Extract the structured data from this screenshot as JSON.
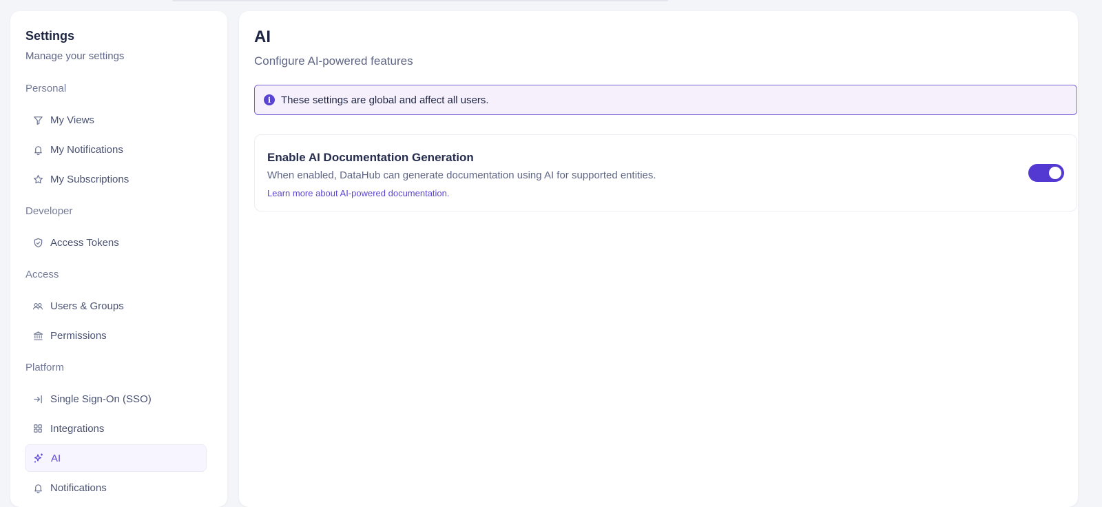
{
  "sidebar": {
    "title": "Settings",
    "subtitle": "Manage your settings",
    "sections": {
      "personal": "Personal",
      "developer": "Developer",
      "access": "Access",
      "platform": "Platform"
    },
    "items": {
      "my_views": "My Views",
      "my_notifications": "My Notifications",
      "my_subscriptions": "My Subscriptions",
      "access_tokens": "Access Tokens",
      "users_groups": "Users & Groups",
      "permissions": "Permissions",
      "sso": "Single Sign-On (SSO)",
      "integrations": "Integrations",
      "ai": "AI",
      "notifications": "Notifications"
    },
    "active_item": "AI"
  },
  "main": {
    "title": "AI",
    "subtitle": "Configure AI-powered features",
    "banner": {
      "icon": "info-icon",
      "text": "These settings are global and affect all users."
    },
    "card": {
      "title": "Enable AI Documentation Generation",
      "description": "When enabled, DataHub can generate documentation using AI for supported entities.",
      "link": "Learn more about AI-powered documentation.",
      "toggle_on": true
    }
  },
  "colors": {
    "accent": "#5338d1",
    "banner_bg": "#f6f0fd",
    "banner_border": "#7a61dc",
    "page_bg": "#f4f5f9"
  }
}
